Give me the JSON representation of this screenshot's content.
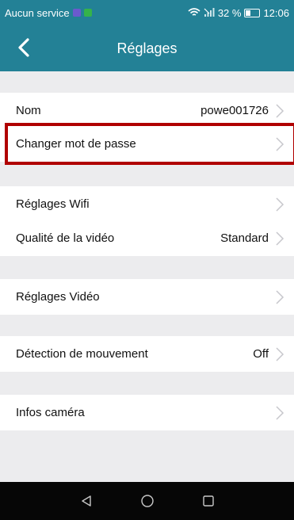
{
  "status_bar": {
    "carrier": "Aucun service",
    "battery_text": "32 %",
    "time": "12:06",
    "notif_colors": [
      "#6a5acd",
      "#35b34a"
    ]
  },
  "header": {
    "title": "Réglages",
    "back_icon": "chevron-left-icon"
  },
  "settings": {
    "name": {
      "label": "Nom",
      "value": "powe001726"
    },
    "password": {
      "label": "Changer mot de passe"
    },
    "wifi": {
      "label": "Réglages Wifi"
    },
    "video_quality": {
      "label": "Qualité de la vidéo",
      "value": "Standard"
    },
    "video_settings": {
      "label": "Réglages Vidéo"
    },
    "motion_detection": {
      "label": "Détection de mouvement",
      "value": "Off"
    },
    "camera_info": {
      "label": "Infos caméra"
    }
  },
  "colors": {
    "accent": "#238196",
    "highlight": "#b00000",
    "background": "#ececee"
  },
  "nav_bar": {
    "icons": [
      "back-triangle-icon",
      "home-circle-icon",
      "recents-square-icon"
    ]
  }
}
